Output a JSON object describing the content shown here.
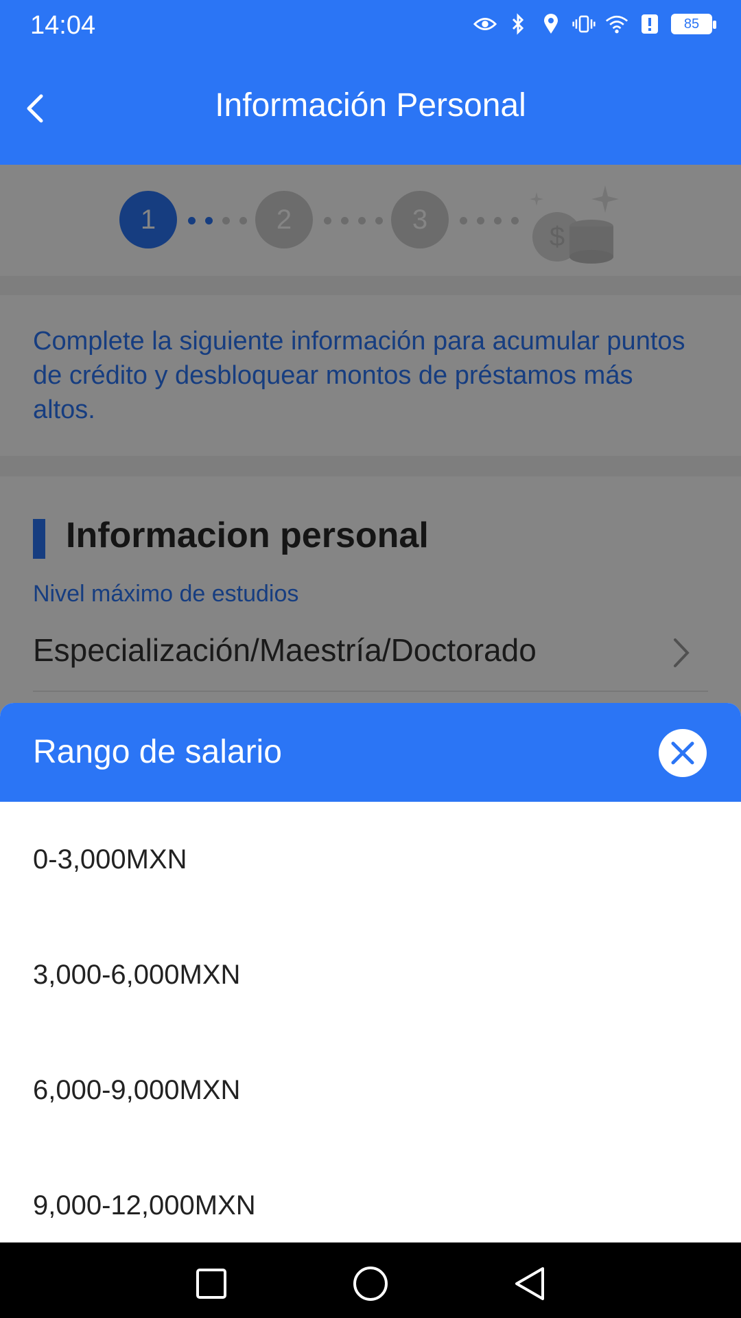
{
  "status_bar": {
    "time": "14:04",
    "battery": "85",
    "icons": [
      "eye-icon",
      "bluetooth-icon",
      "location-icon",
      "vibrate-icon",
      "wifi-icon",
      "alert-icon",
      "battery-icon"
    ]
  },
  "header": {
    "title": "Información Personal",
    "back_icon": "back-arrow-icon"
  },
  "stepper": {
    "steps": [
      "1",
      "2",
      "3"
    ],
    "active_step": "1",
    "final_icon": "coins-icon"
  },
  "intro_text": "Complete la siguiente información para acumular puntos de crédito y desbloquear montos de préstamos más altos.",
  "section": {
    "title": "Informacion personal",
    "field_label": "Nivel máximo de estudios",
    "field_value": "Especialización/Maestría/Doctorado"
  },
  "sheet": {
    "title": "Rango de salario",
    "options": [
      "0-3,000MXN",
      "3,000-6,000MXN",
      "6,000-9,000MXN",
      "9,000-12,000MXN"
    ]
  },
  "colors": {
    "primary": "#2b75f5",
    "inactive": "#cfcfcf"
  }
}
